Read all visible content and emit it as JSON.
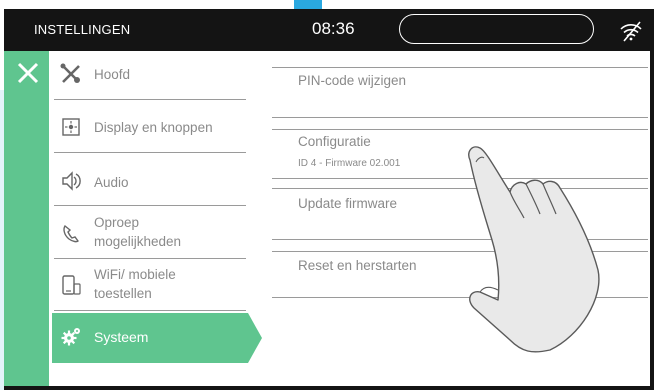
{
  "header": {
    "title": "INSTELLINGEN",
    "clock": "08:36"
  },
  "menu": {
    "items": [
      {
        "label": "Hoofd",
        "icon": "wrench-screwdriver-icon"
      },
      {
        "label": "Display en knoppen",
        "icon": "display-icon"
      },
      {
        "label": "Audio",
        "icon": "speaker-icon"
      },
      {
        "label_line1": "Oproep",
        "label_line2": "mogelijkheden",
        "icon": "phone-icon"
      },
      {
        "label_line1": "WiFi/ mobiele",
        "label_line2": "toestellen",
        "icon": "mobile-device-icon"
      }
    ],
    "active": {
      "label": "Systeem",
      "icon": "gears-icon"
    }
  },
  "content": {
    "pin": "PIN-code wijzigen",
    "configuratie": "Configuratie",
    "configuratie_sub": "ID 4 - Firmware 02.001",
    "update": "Update firmware",
    "reset": "Reset en herstarten"
  },
  "colors": {
    "accent_green": "#5fc58f",
    "topbar": "#141414",
    "text_gray": "#8a8a8a"
  }
}
